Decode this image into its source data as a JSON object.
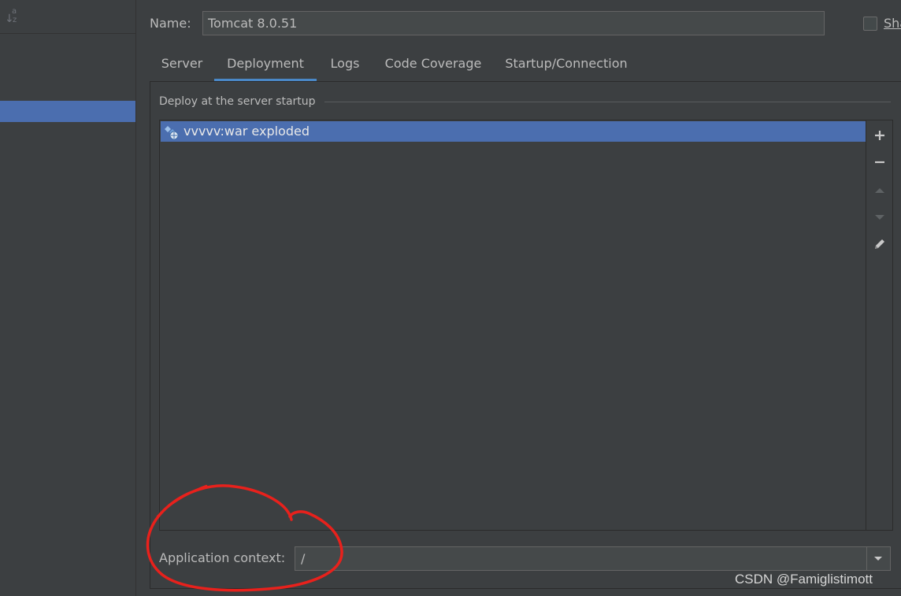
{
  "dialog": {
    "name_label": "Name:",
    "name_value": "Tomcat 8.0.51",
    "share_label": "Sha",
    "share_checked": false
  },
  "tabs": [
    {
      "label": "Server",
      "active": false
    },
    {
      "label": "Deployment",
      "active": true
    },
    {
      "label": "Logs",
      "active": false
    },
    {
      "label": "Code Coverage",
      "active": false
    },
    {
      "label": "Startup/Connection",
      "active": false
    }
  ],
  "deployment": {
    "section_title": "Deploy at the server startup",
    "artifacts": [
      {
        "label": "vvvvv:war exploded",
        "icon": "artifact-war-icon",
        "selected": true
      }
    ],
    "toolbar": [
      "add-icon",
      "remove-icon",
      "move-up-icon",
      "move-down-icon",
      "edit-icon"
    ]
  },
  "context": {
    "label": "Application context:",
    "value": "/"
  },
  "left_panel": {
    "sort_icon": "sort-alphabetically-icon"
  },
  "colors": {
    "background": "#3c3f41",
    "selection": "#4b6eaf",
    "tab_underline": "#4a88c7",
    "annotation": "#e8211c"
  },
  "watermark": "CSDN @Famiglistimott"
}
